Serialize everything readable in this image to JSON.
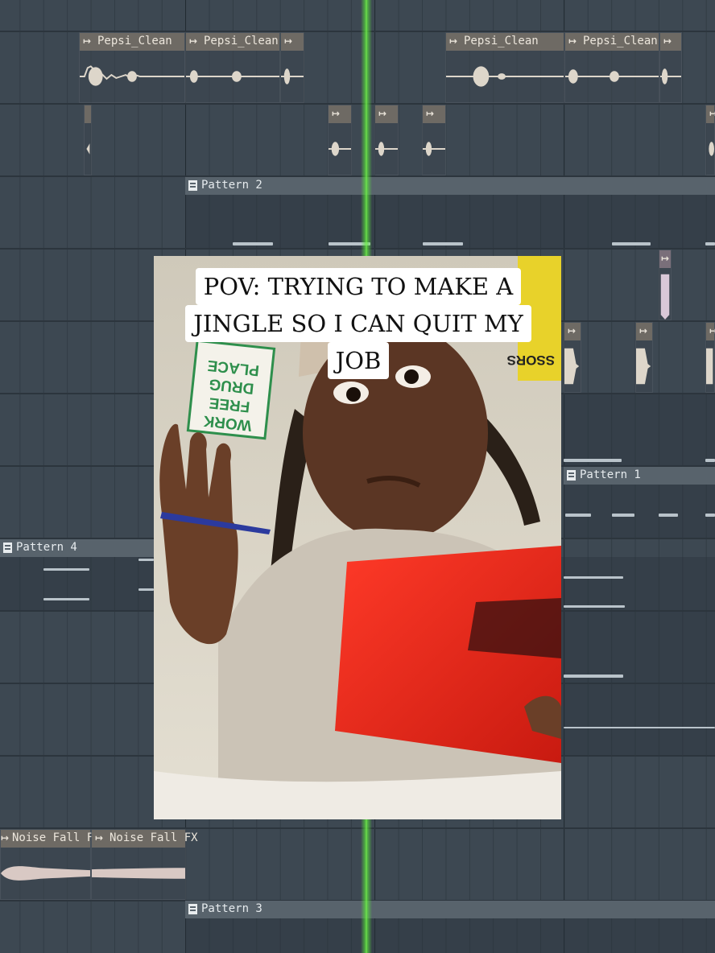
{
  "playlist": {
    "clips": {
      "pepsi_1": "Pepsi_Clean",
      "pepsi_2": "Pepsi_Clean",
      "pepsi_3": "Pepsi_Clean",
      "pepsi_4": "Pepsi_Clean",
      "noise_1": "Noise Fall FX",
      "noise_2": "Noise Fall FX"
    },
    "patterns": {
      "pattern_2": "Pattern 2",
      "pattern_1": "Pattern 1",
      "pattern_4": "Pattern 4",
      "pattern_3": "Pattern 3"
    }
  },
  "video": {
    "caption_lines": [
      "POV: TRYING TO MAKE A",
      "JINGLE SO I CAN QUIT MY",
      "JOB"
    ],
    "poster_sign": [
      "WORK",
      "FREE",
      "DRUG",
      "PLACE"
    ],
    "poster_right": "SSORS"
  },
  "colors": {
    "playhead": "#7be34f",
    "background": "#3d4852",
    "red_folder": "#e82b1c"
  }
}
